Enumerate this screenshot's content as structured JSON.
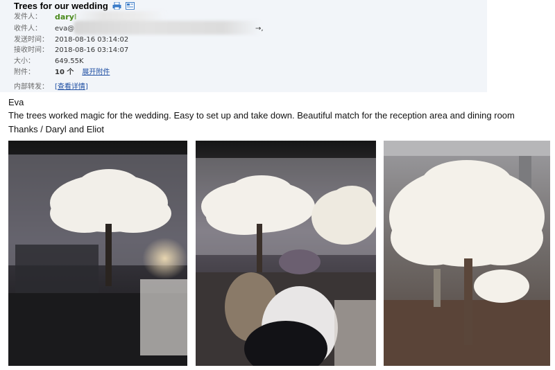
{
  "email": {
    "subject": "Trees for our wedding",
    "icons": [
      "print-icon",
      "view-icon"
    ],
    "sender_label": "发件人：",
    "sender_name": "daryl",
    "sender_rest": "<",
    "recipient_label": "收件人：",
    "recipient_value": "eva@",
    "recipient_tail": "→,",
    "sent_label": "发送时间：",
    "sent_value": "2018-08-16 03:14:02",
    "received_label": "接收时间：",
    "received_value": "2018-08-16 03:14:07",
    "size_label": "大小：",
    "size_value": "649.55K",
    "attach_label": "附件：",
    "attach_count": "10 个",
    "attach_expand": "展开附件",
    "forward_label": "内部转发：",
    "forward_link": "查看详情"
  },
  "message": {
    "greeting": "Eva",
    "body": "The trees worked magic for the wedding. Easy to set up and take down. Beautiful match for the reception area and dining room",
    "signoff": "Thanks / Daryl and Eliot"
  },
  "photos": [
    {
      "name": "wedding-photo-1",
      "alt": "white blossom tree in dim reception hall"
    },
    {
      "name": "wedding-photo-2",
      "alt": "guests seated under white blossom trees"
    },
    {
      "name": "wedding-photo-3",
      "alt": "white blossom tree in warehouse"
    }
  ]
}
